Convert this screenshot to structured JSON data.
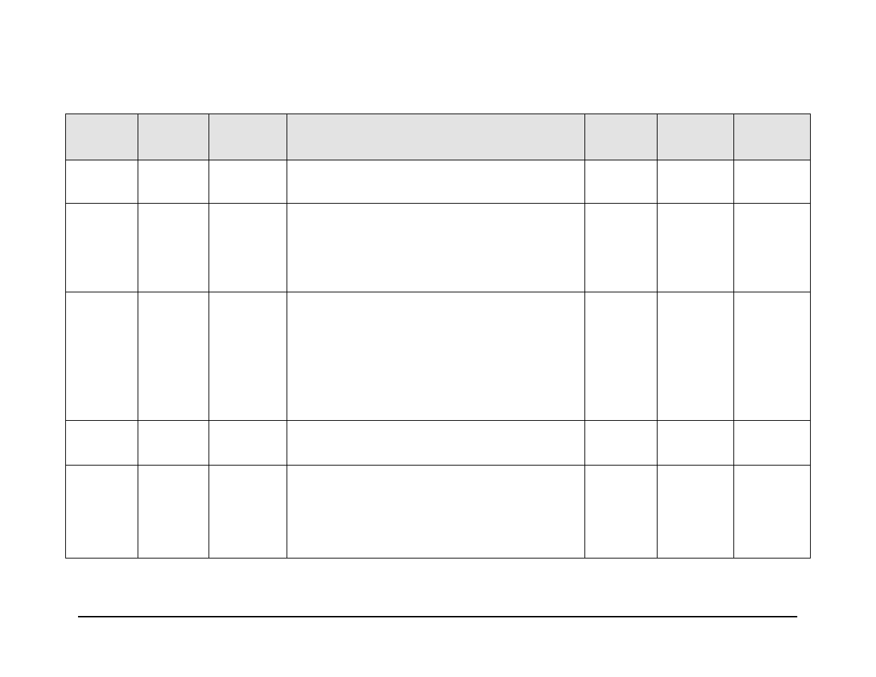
{
  "table": {
    "headers": [
      "",
      "",
      "",
      "",
      "",
      "",
      ""
    ],
    "rows": [
      [
        "",
        "",
        "",
        "",
        "",
        "",
        ""
      ],
      [
        "",
        "",
        "",
        "",
        "",
        "",
        ""
      ],
      [
        "",
        "",
        "",
        "",
        "",
        "",
        ""
      ],
      [
        "",
        "",
        "",
        "",
        "",
        "",
        ""
      ],
      [
        "",
        "",
        "",
        "",
        "",
        "",
        ""
      ]
    ]
  }
}
